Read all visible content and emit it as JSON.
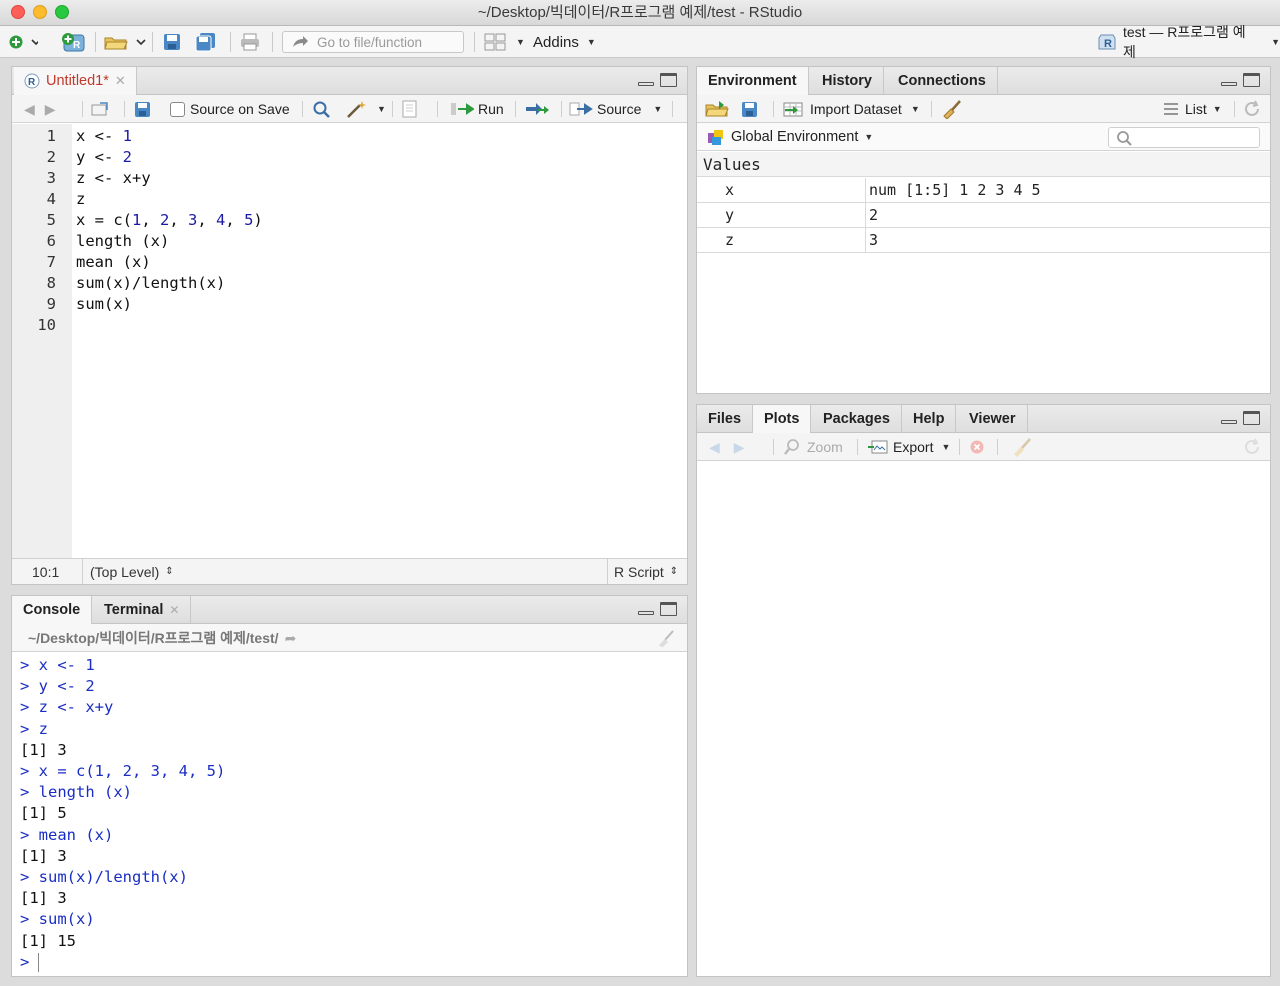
{
  "window": {
    "title": "~/Desktop/빅데이터/R프로그램 예제/test - RStudio"
  },
  "toolbar": {
    "goto_placeholder": "Go to file/function",
    "addins_label": "Addins",
    "project_label": "test — R프로그램 예제"
  },
  "editor": {
    "tab_label": "Untitled1*",
    "source_on_save_label": "Source on Save",
    "run_label": "Run",
    "source_label": "Source",
    "lines": [
      {
        "n": "1",
        "code": "x <- 1"
      },
      {
        "n": "2",
        "code": "y <- 2"
      },
      {
        "n": "3",
        "code": "z <- x+y"
      },
      {
        "n": "4",
        "code": "z"
      },
      {
        "n": "5",
        "code": "x = c(1, 2, 3, 4, 5)"
      },
      {
        "n": "6",
        "code": "length (x)"
      },
      {
        "n": "7",
        "code": "mean (x)"
      },
      {
        "n": "8",
        "code": "sum(x)/length(x)"
      },
      {
        "n": "9",
        "code": "sum(x)"
      },
      {
        "n": "10",
        "code": ""
      }
    ],
    "status_position": "10:1",
    "status_scope": "(Top Level)",
    "status_filetype": "R Script"
  },
  "console": {
    "tab_console": "Console",
    "tab_terminal": "Terminal",
    "path": "~/Desktop/빅데이터/R프로그램 예제/test/",
    "lines": [
      {
        "type": "input",
        "text": "> x <- 1"
      },
      {
        "type": "input",
        "text": "> y <- 2"
      },
      {
        "type": "input",
        "text": "> z <- x+y"
      },
      {
        "type": "input",
        "text": "> z"
      },
      {
        "type": "output",
        "text": "[1] 3"
      },
      {
        "type": "input",
        "text": "> x = c(1, 2, 3, 4, 5)"
      },
      {
        "type": "input",
        "text": "> length (x)"
      },
      {
        "type": "output",
        "text": "[1] 5"
      },
      {
        "type": "input",
        "text": "> mean (x)"
      },
      {
        "type": "output",
        "text": "[1] 3"
      },
      {
        "type": "input",
        "text": "> sum(x)/length(x)"
      },
      {
        "type": "output",
        "text": "[1] 3"
      },
      {
        "type": "input",
        "text": "> sum(x)"
      },
      {
        "type": "output",
        "text": "[1] 15"
      },
      {
        "type": "input",
        "text": "> "
      }
    ]
  },
  "environment": {
    "tabs": [
      "Environment",
      "History",
      "Connections"
    ],
    "import_dataset_label": "Import Dataset",
    "list_label": "List",
    "scope_label": "Global Environment",
    "section_label": "Values",
    "rows": [
      {
        "name": "x",
        "value": "num [1:5] 1 2 3 4 5"
      },
      {
        "name": "y",
        "value": "2"
      },
      {
        "name": "z",
        "value": "3"
      }
    ]
  },
  "files": {
    "tabs": [
      "Files",
      "Plots",
      "Packages",
      "Help",
      "Viewer"
    ],
    "zoom_label": "Zoom",
    "export_label": "Export"
  },
  "colors": {
    "accent_red": "#c0392b",
    "prompt_blue": "#1a2ec4",
    "number_blue": "#1a1aa6"
  }
}
